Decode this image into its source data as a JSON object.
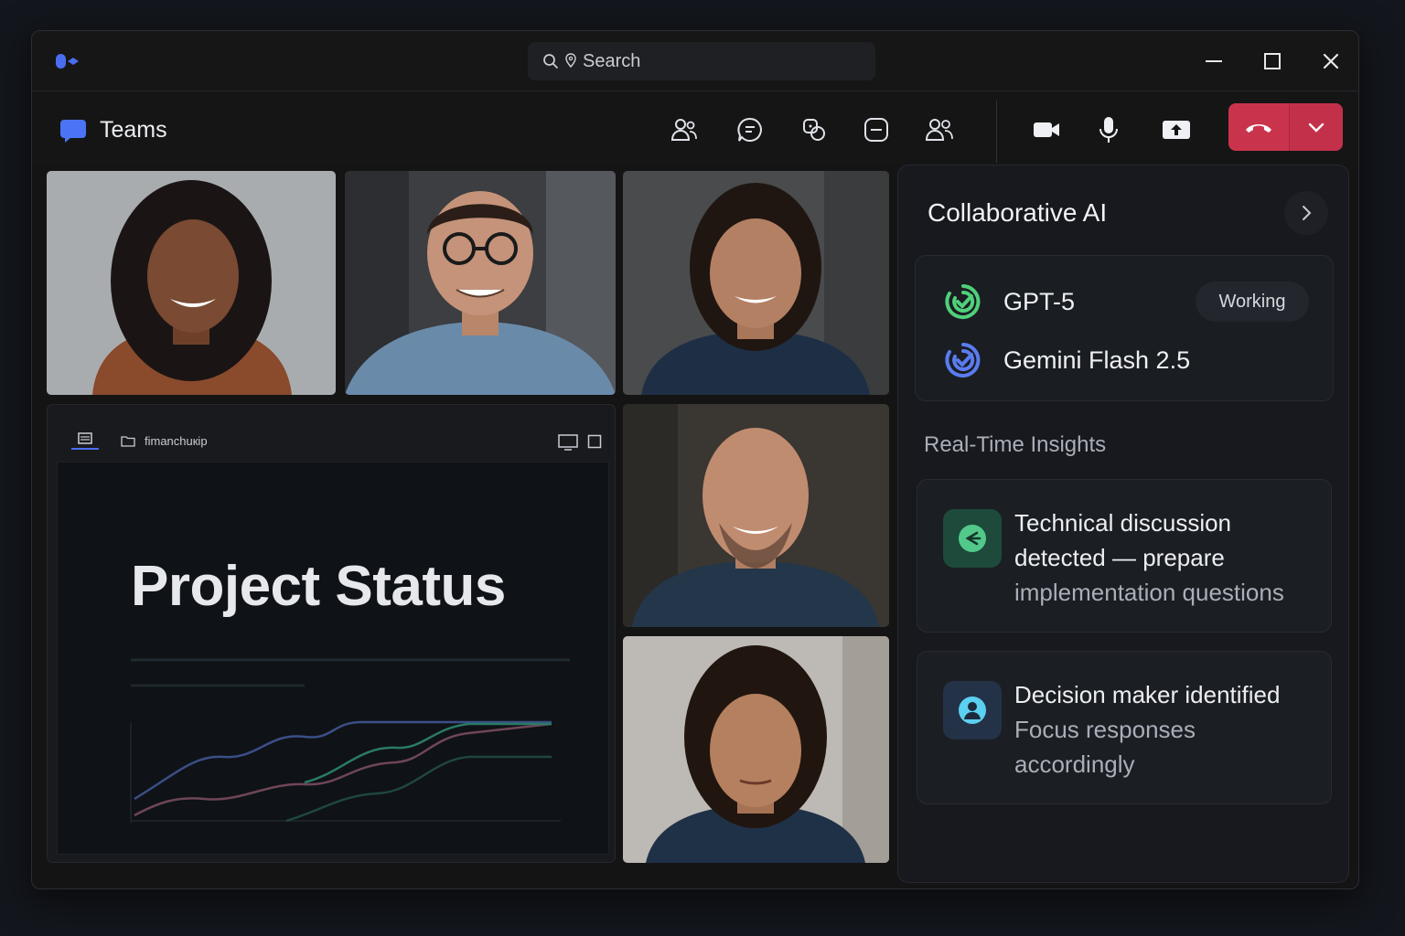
{
  "titlebar": {
    "search_placeholder": "Search"
  },
  "header": {
    "app_name": "Teams"
  },
  "share": {
    "file_name": "fimanchuкip",
    "slide_title": "Project Status"
  },
  "ai_panel": {
    "title": "Collaborative AI",
    "models": [
      {
        "name": "GPT-5",
        "status": "Working",
        "icon": "swirl-icon",
        "color": "#4fd07a"
      },
      {
        "name": "Gemini Flash 2.5",
        "icon": "swirl-icon",
        "color": "#5a7cf0"
      }
    ],
    "insights_heading": "Real-Time Insights",
    "insights": [
      {
        "icon": "arrow-circle-icon",
        "accent": "#52c98a",
        "line1": "Technical discussion",
        "line2_main": "detected",
        "line2_sub": " — prepare",
        "line3": "implementation questions"
      },
      {
        "icon": "person-circle-icon",
        "accent": "#5bd0f0",
        "line1": "Decision maker identified",
        "line2": "Focus responses",
        "line3": "accordingly"
      }
    ]
  },
  "colors": {
    "leave_button": "#c9344c",
    "brand_blue": "#3b6df0"
  }
}
